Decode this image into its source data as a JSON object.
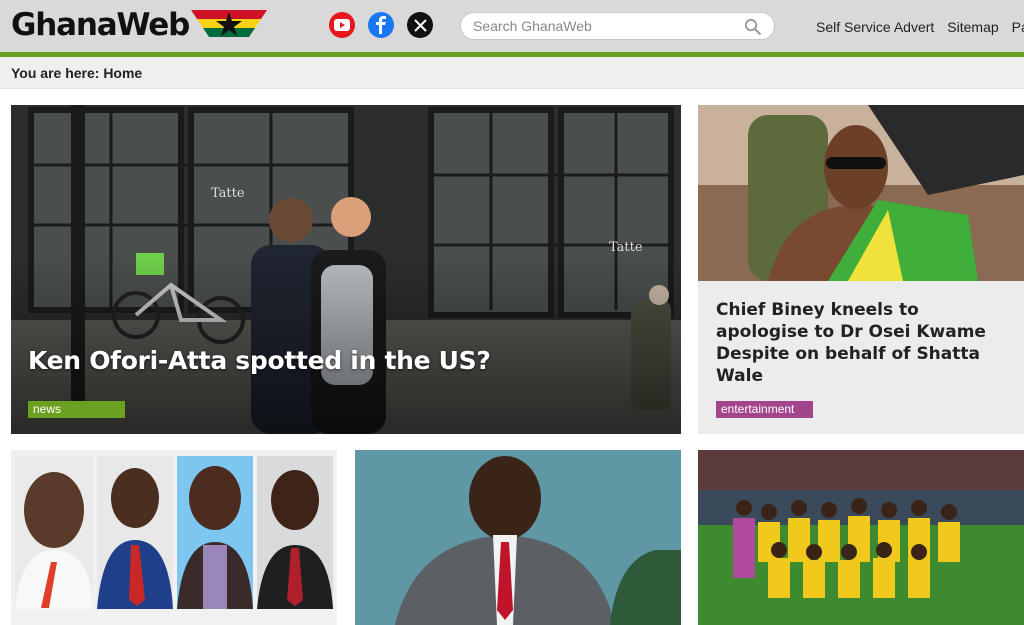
{
  "brand": {
    "name": "GhanaWeb"
  },
  "header": {
    "social": [
      {
        "name": "youtube",
        "icon": "youtube-icon",
        "color": "#e6171e"
      },
      {
        "name": "facebook",
        "icon": "facebook-icon",
        "color": "#1877f2"
      },
      {
        "name": "x",
        "icon": "x-icon",
        "color": "#111111"
      }
    ],
    "search": {
      "placeholder": "Search GhanaWeb",
      "icon": "search-icon"
    },
    "nav": [
      "Self Service Advert",
      "Sitemap",
      "Partners"
    ]
  },
  "breadcrumb": "You are here: Home",
  "hero": {
    "title": "Ken Ofori-Atta spotted in the US?",
    "tag": "news",
    "tag_color": "#6aa121"
  },
  "side_story": {
    "title": "Chief Biney kneels to apologise to Dr Osei Kwame Despite on behalf of Shatta Wale",
    "tag": "entertainment",
    "tag_color": "#a3458d"
  },
  "theme": {
    "accent_green": "#6aa121",
    "header_bg": "#d9d9d9"
  }
}
